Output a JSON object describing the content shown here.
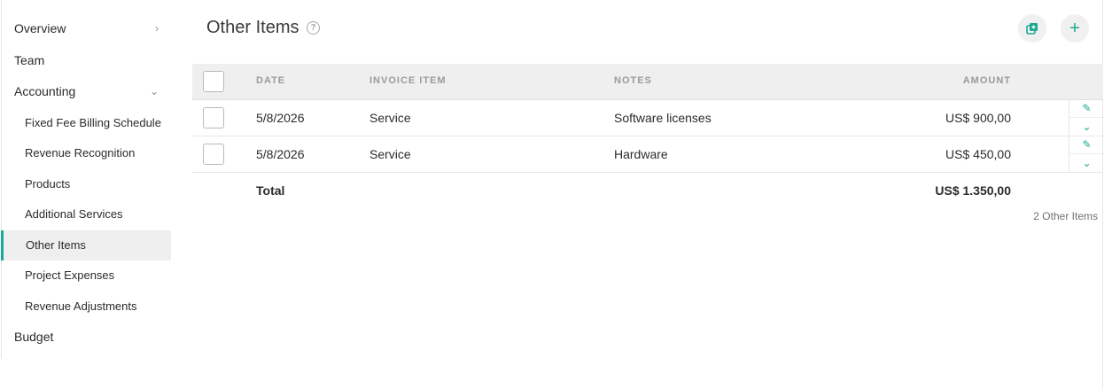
{
  "sidebar": {
    "items": [
      {
        "label": "Overview"
      },
      {
        "label": "Team"
      },
      {
        "label": "Accounting"
      },
      {
        "label": "Fixed Fee Billing Schedule"
      },
      {
        "label": "Revenue Recognition"
      },
      {
        "label": "Products"
      },
      {
        "label": "Additional Services"
      },
      {
        "label": "Other Items"
      },
      {
        "label": "Project Expenses"
      },
      {
        "label": "Revenue Adjustments"
      },
      {
        "label": "Budget"
      }
    ],
    "active": "Other Items"
  },
  "header": {
    "title": "Other Items",
    "help_icon": "question-circle-icon",
    "copy_icon": "copy-icon",
    "add_icon": "plus-icon"
  },
  "table": {
    "columns": [
      "DATE",
      "INVOICE ITEM",
      "NOTES",
      "AMOUNT"
    ],
    "rows": [
      {
        "date": "5/8/2026",
        "item": "Service",
        "notes": "Software licenses",
        "amount": "US$ 900,00"
      },
      {
        "date": "5/8/2026",
        "item": "Service",
        "notes": "Hardware",
        "amount": "US$ 450,00"
      }
    ],
    "total_label": "Total",
    "total_amount": "US$ 1.350,00",
    "count_label": "2 Other Items"
  },
  "colors": {
    "accent": "#1aa994",
    "header_bg": "#efefef",
    "active_bg": "#efefef"
  }
}
